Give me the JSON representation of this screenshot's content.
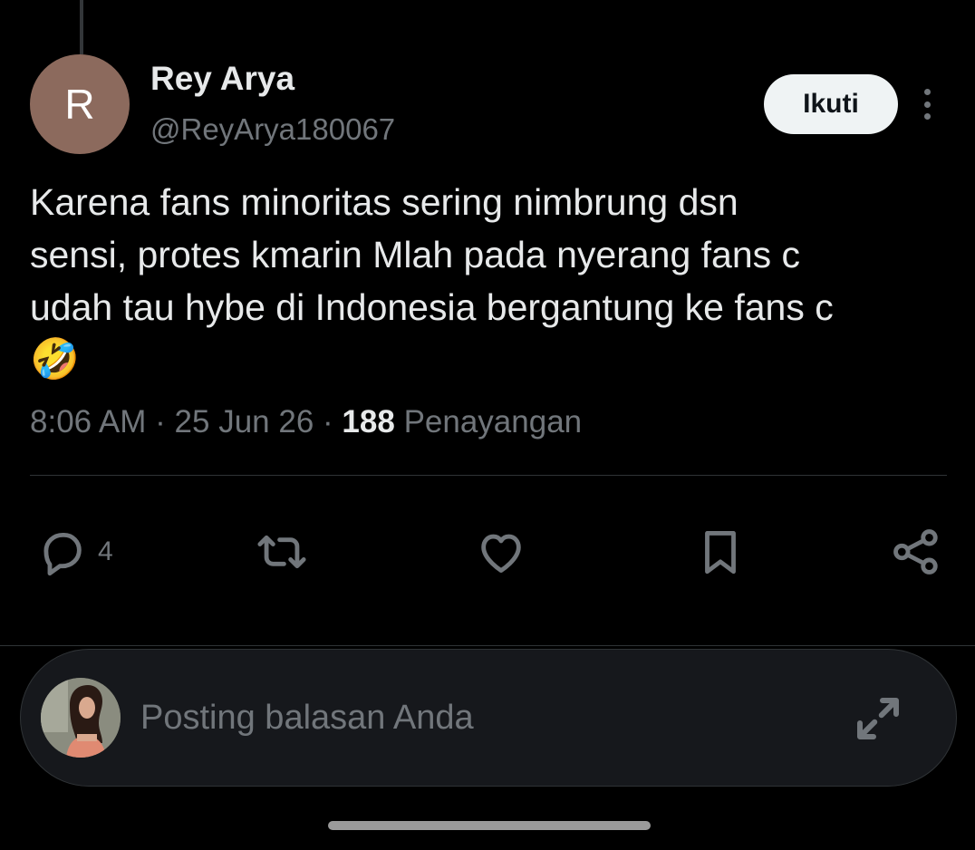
{
  "tweet": {
    "author": {
      "avatar_letter": "R",
      "display_name": "Rey Arya",
      "handle": "@ReyArya180067",
      "avatar_color": "#8c6a5d"
    },
    "follow_label": "Ikuti",
    "text_lines": [
      "Karena fans minoritas sering nimbrung dsn",
      "sensi, protes kmarin Mlah pada nyerang fans c",
      "udah tau hybe di Indonesia bergantung ke fans c"
    ],
    "emoji": "🤣",
    "time": "8:06 AM",
    "date": "25 Jun 26",
    "views_count": "188",
    "views_label": "Penayangan",
    "separator": "·"
  },
  "actions": {
    "reply_count": "4",
    "icons": [
      "reply-icon",
      "retweet-icon",
      "like-icon",
      "bookmark-icon",
      "share-icon"
    ]
  },
  "reply_bar": {
    "placeholder": "Posting balasan Anda",
    "icon": "expand-icon"
  },
  "colors": {
    "background": "#000000",
    "text_primary": "#e7e9ea",
    "text_secondary": "#71767b",
    "divider": "#2f3336",
    "follow_button_bg": "#eff3f4"
  }
}
